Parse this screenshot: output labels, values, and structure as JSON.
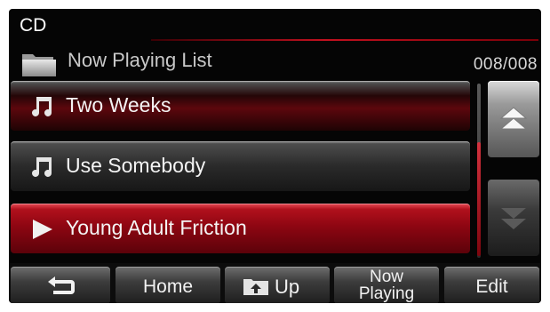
{
  "header": {
    "title": "CD"
  },
  "pathbar": {
    "folder_icon": "folder-icon",
    "label": "Now Playing List",
    "counter": "008/008"
  },
  "tracks": [
    {
      "label": "Two Weeks",
      "icon": "music-note-icon",
      "state": "normal"
    },
    {
      "label": "Use Somebody",
      "icon": "music-note-icon",
      "state": "normal"
    },
    {
      "label": "Young Adult Friction",
      "icon": "play-icon",
      "state": "playing"
    }
  ],
  "scroll": {
    "up_icon": "double-chevron-up-icon",
    "down_icon": "double-chevron-down-icon"
  },
  "soft_keys": {
    "back_icon": "back-arrow-icon",
    "home_label": "Home",
    "up_icon": "folder-up-icon",
    "up_label": "Up",
    "now_playing_line1": "Now",
    "now_playing_line2": "Playing",
    "edit_label": "Edit"
  },
  "colors": {
    "accent": "#b0101c",
    "background": "#050505",
    "text": "#f4f4f4"
  }
}
